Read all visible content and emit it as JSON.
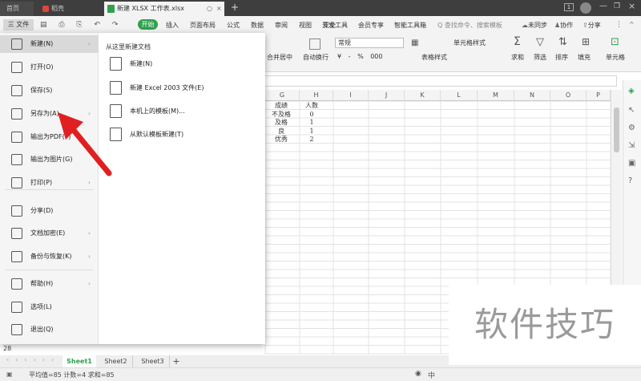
{
  "titlebar": {
    "tabs": [
      "首页",
      "稻壳",
      "新建 XLSX 工作表.xlsx"
    ],
    "new_tab": "+",
    "badge": "1"
  },
  "toolbar": {
    "file_menu": "三 文件",
    "start": "开始",
    "tabs": [
      "插入",
      "页面布局",
      "公式",
      "数据",
      "审阅",
      "视图",
      "安全",
      "开发工具",
      "会员专享",
      "智能工具箱"
    ],
    "search_placeholder": "Q 查找命令、搜索模板",
    "unsync": "未同步",
    "collab": "协作",
    "share": "分享",
    "ribbon": {
      "merge_center": "合并居中",
      "wrap": "自动换行",
      "number_format": "常规",
      "currency": "¥ - % 000",
      "table_style": "表格样式",
      "cell_style": "单元格样式",
      "sum": "求和",
      "filter": "筛选",
      "sort": "排序",
      "fill": "填充",
      "cells": "单元格"
    }
  },
  "sheet": {
    "columns": [
      "G",
      "H",
      "I",
      "J",
      "K",
      "L",
      "M",
      "N",
      "O",
      "P"
    ],
    "header_row": [
      "成绩",
      "人数"
    ],
    "rows": [
      [
        "不及格",
        "0"
      ],
      [
        "及格",
        "1"
      ],
      [
        "良",
        "1"
      ],
      [
        "优秀",
        "2"
      ]
    ],
    "row_number": "28",
    "tabs": [
      "Sheet1",
      "Sheet2",
      "Sheet3"
    ],
    "add_sheet": "+"
  },
  "status": {
    "text": "平均值=85  计数=4  求和=85"
  },
  "file_menu": {
    "items": [
      {
        "label": "新建(N)",
        "icon": "new-file-icon",
        "arrow": "›"
      },
      {
        "label": "打开(O)",
        "icon": "folder-open-icon",
        "arrow": ""
      },
      {
        "label": "保存(S)",
        "icon": "save-icon",
        "arrow": ""
      },
      {
        "label": "另存为(A)",
        "icon": "save-as-icon",
        "arrow": "›"
      },
      {
        "label": "输出为PDF(F)",
        "icon": "pdf-icon",
        "arrow": ""
      },
      {
        "label": "输出为图片(G)",
        "icon": "image-icon",
        "arrow": ""
      },
      {
        "label": "打印(P)",
        "icon": "print-icon",
        "arrow": "›"
      },
      {
        "label": "分享(D)",
        "icon": "share-icon",
        "arrow": ""
      },
      {
        "label": "文档加密(E)",
        "icon": "encrypt-icon",
        "arrow": "›"
      },
      {
        "label": "备份与恢复(K)",
        "icon": "backup-icon",
        "arrow": "›"
      },
      {
        "label": "帮助(H)",
        "icon": "help-icon",
        "arrow": "›"
      },
      {
        "label": "选项(L)",
        "icon": "options-icon",
        "arrow": ""
      },
      {
        "label": "退出(Q)",
        "icon": "exit-icon",
        "arrow": ""
      }
    ],
    "submenu_title": "从这里新建文档",
    "submenu": [
      {
        "label": "新建(N)",
        "icon": "new-sheet-icon"
      },
      {
        "label": "新建 Excel 2003 文件(E)",
        "icon": "new-excel-icon"
      },
      {
        "label": "本机上的模板(M)...",
        "icon": "local-template-icon"
      },
      {
        "label": "从默认模板新建(T)",
        "icon": "default-template-icon"
      }
    ]
  },
  "watermark": "软件技巧",
  "colors": {
    "accent": "#2fa14d",
    "arrow": "#e02020"
  }
}
